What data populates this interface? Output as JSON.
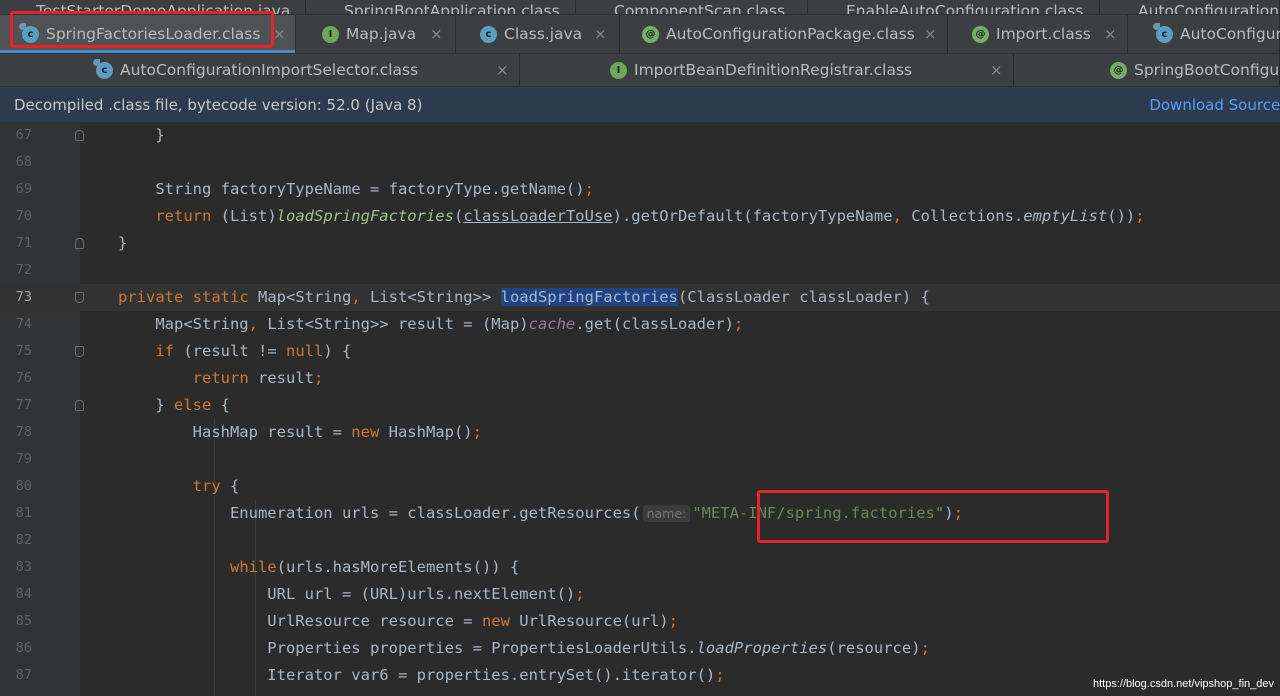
{
  "tabs": {
    "row0": [
      {
        "label": "TestStarterDemoApplication.java"
      },
      {
        "label": "SpringBootApplication.class"
      },
      {
        "label": "ComponentScan.class"
      },
      {
        "label": "EnableAutoConfiguration.class"
      },
      {
        "label": "AutoConfigurationI"
      }
    ],
    "row1": [
      {
        "label": "SpringFactoriesLoader.class",
        "active": true,
        "icon": "decompiled-class-icon"
      },
      {
        "label": "Map.java",
        "icon": "interface-icon"
      },
      {
        "label": "Class.java",
        "icon": "class-icon"
      },
      {
        "label": "AutoConfigurationPackage.class",
        "icon": "annotation-icon"
      },
      {
        "label": "Import.class",
        "icon": "annotation-icon"
      },
      {
        "label": "AutoConfigur",
        "icon": "class-icon"
      }
    ],
    "row2": [
      {
        "label": "AutoConfigurationImportSelector.class",
        "icon": "class-icon"
      },
      {
        "label": "ImportBeanDefinitionRegistrar.class",
        "icon": "interface-icon"
      },
      {
        "label": "SpringBootConfigur",
        "icon": "annotation-icon"
      }
    ],
    "close_glyph": "×"
  },
  "icon_letters": {
    "c": "c",
    "i": "I",
    "a": "@"
  },
  "infobar": {
    "text": "Decompiled .class file, bytecode version: 52.0 (Java 8)",
    "link": "Download Sources"
  },
  "editor": {
    "current_line": "73",
    "lines": [
      {
        "num": "67"
      },
      {
        "num": "68"
      },
      {
        "num": "69"
      },
      {
        "num": "70"
      },
      {
        "num": "71"
      },
      {
        "num": "72"
      },
      {
        "num": "73"
      },
      {
        "num": "74"
      },
      {
        "num": "75"
      },
      {
        "num": "76"
      },
      {
        "num": "77"
      },
      {
        "num": "78"
      },
      {
        "num": "79"
      },
      {
        "num": "80"
      },
      {
        "num": "81"
      },
      {
        "num": "82"
      },
      {
        "num": "83"
      },
      {
        "num": "84"
      },
      {
        "num": "85"
      },
      {
        "num": "86"
      },
      {
        "num": "87"
      }
    ],
    "hint_name": "name:"
  },
  "watermark": "https://blog.csdn.net/vipshop_fin_dev",
  "colors": {
    "background": "#2b2b2b",
    "keyword": "#cc7832",
    "string": "#6a8759",
    "method_italic": "#9ec28a",
    "static_field": "#9876aa",
    "accent": "#4a88c7",
    "annotation_highlight": "#e4242b"
  }
}
